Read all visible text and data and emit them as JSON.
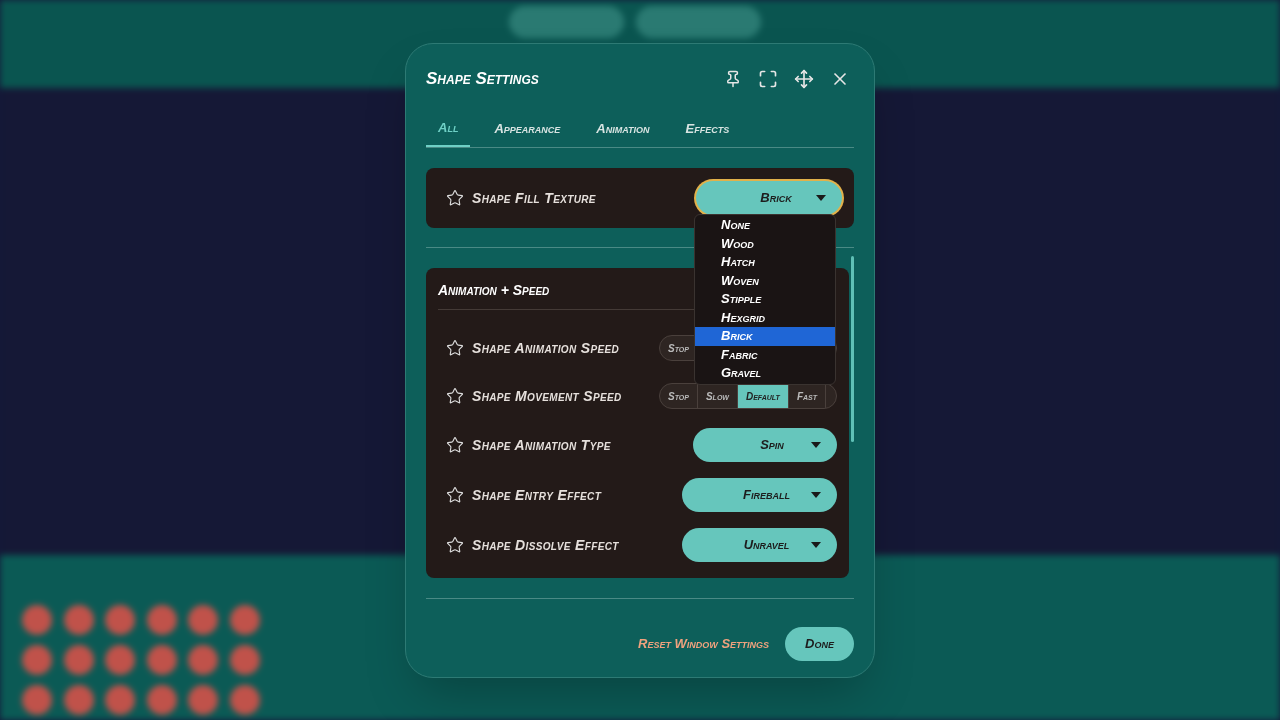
{
  "dialog": {
    "title": "Shape Settings",
    "tabs": [
      {
        "label": "All",
        "selected": true
      },
      {
        "label": "Appearance",
        "selected": false
      },
      {
        "label": "Animation",
        "selected": false
      },
      {
        "label": "Effects",
        "selected": false
      }
    ],
    "top_setting": {
      "label": "Shape Fill Texture",
      "value": "Brick",
      "open": true,
      "options": [
        {
          "label": "None",
          "selected": false
        },
        {
          "label": "Wood",
          "selected": false
        },
        {
          "label": "Hatch",
          "selected": false
        },
        {
          "label": "Woven",
          "selected": false
        },
        {
          "label": "Stipple",
          "selected": false
        },
        {
          "label": "Hexgrid",
          "selected": false
        },
        {
          "label": "Brick",
          "selected": true
        },
        {
          "label": "Fabric",
          "selected": false
        },
        {
          "label": "Gravel",
          "selected": false
        }
      ]
    },
    "section": {
      "title": "Animation + Speed",
      "rows": [
        {
          "kind": "segmented",
          "label": "Shape Animation Speed",
          "segments": [
            {
              "label": "Stop",
              "selected": false
            }
          ]
        },
        {
          "kind": "segmented",
          "label": "Shape Movement Speed",
          "segments": [
            {
              "label": "Stop",
              "selected": false
            },
            {
              "label": "Slow",
              "selected": false
            },
            {
              "label": "Default",
              "selected": true
            },
            {
              "label": "Fast",
              "selected": false
            }
          ]
        },
        {
          "kind": "dropdown",
          "label": "Shape Animation Type",
          "value": "Spin"
        },
        {
          "kind": "dropdown",
          "label": "Shape Entry Effect",
          "value": "Fireball"
        },
        {
          "kind": "dropdown",
          "label": "Shape Dissolve Effect",
          "value": "Unravel"
        }
      ]
    },
    "reset_link": "Reset Window Settings",
    "done_button": "Done"
  }
}
